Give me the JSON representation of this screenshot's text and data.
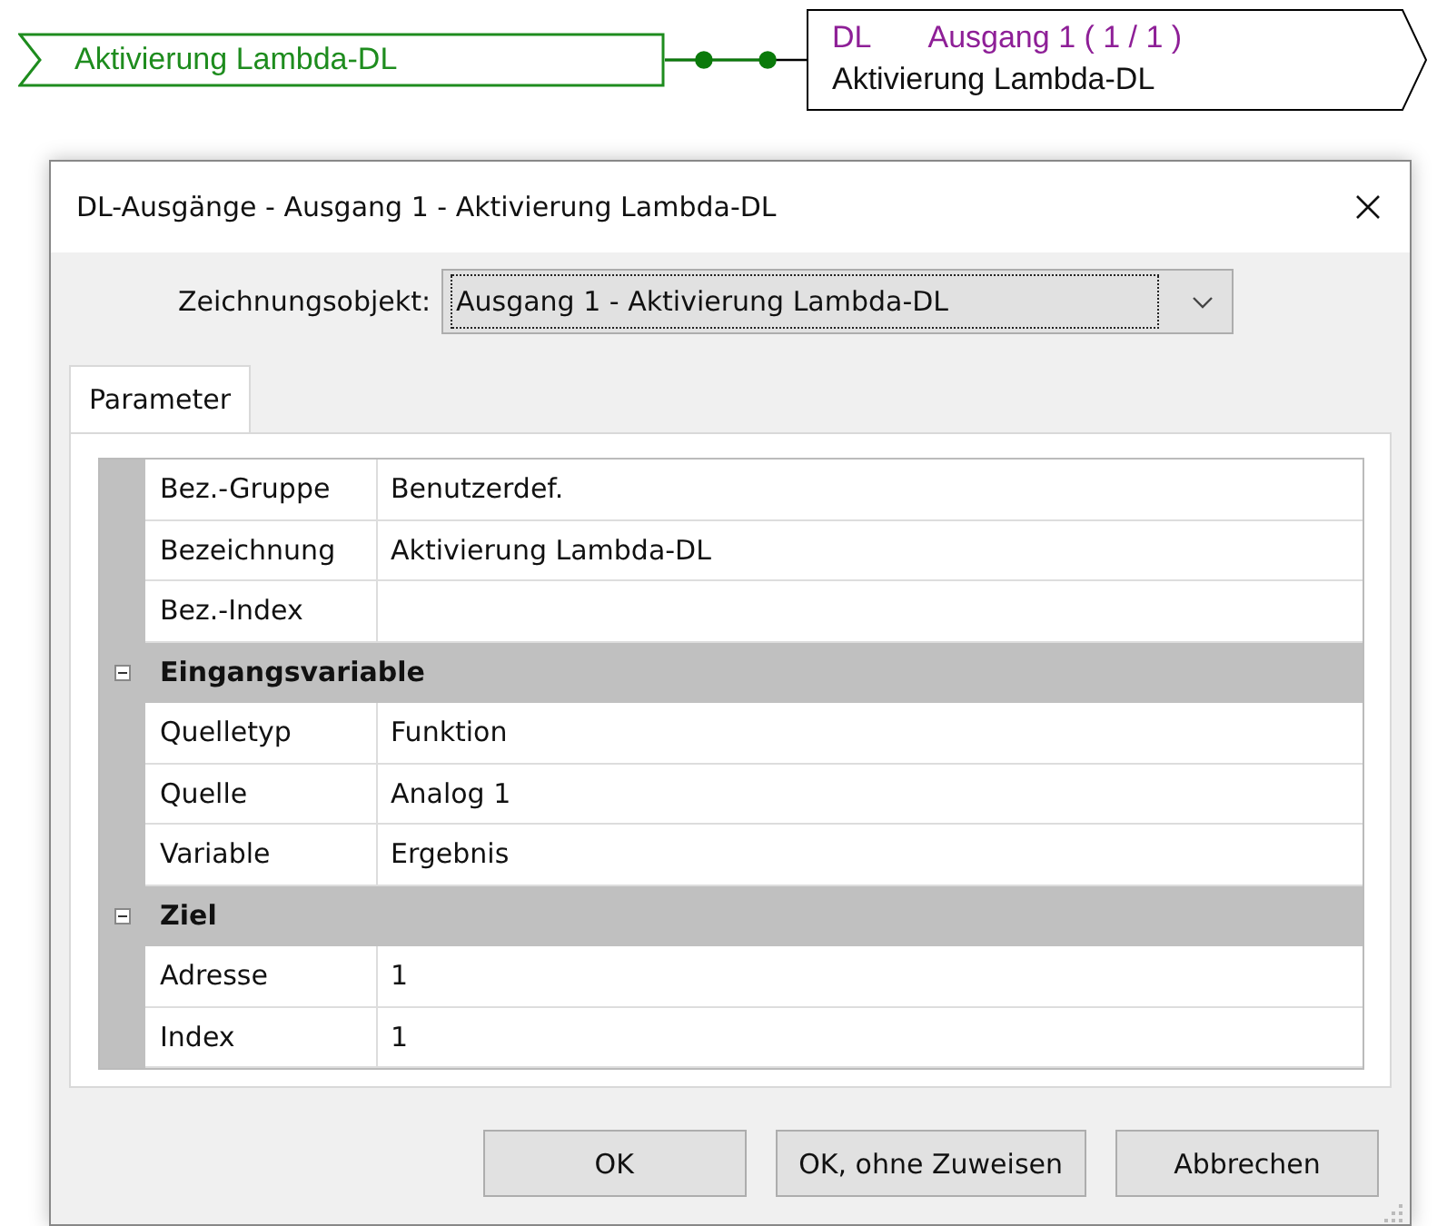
{
  "diagram": {
    "input_tag": "Aktivierung Lambda-DL",
    "output_block": {
      "type": "DL",
      "title": "Ausgang 1 ( 1 / 1 )",
      "name": "Aktivierung Lambda-DL"
    }
  },
  "dialog": {
    "title": "DL-Ausgänge - Ausgang 1 - Aktivierung Lambda-DL",
    "object_label": "Zeichnungsobjekt:",
    "object_value": "Ausgang 1 - Aktivierung Lambda-DL",
    "tabs": [
      {
        "label": "Parameter",
        "selected": true
      }
    ],
    "properties": [
      {
        "kind": "row",
        "label": "Bez.-Gruppe",
        "value": "Benutzerdef."
      },
      {
        "kind": "row",
        "label": "Bezeichnung",
        "value": "Aktivierung Lambda-DL"
      },
      {
        "kind": "row",
        "label": "Bez.-Index"
      },
      {
        "kind": "group",
        "label": "Eingangsvariable",
        "expanded": true
      },
      {
        "kind": "row",
        "label": "Quelletyp",
        "value": "Funktion"
      },
      {
        "kind": "row",
        "label": "Quelle",
        "value": "Analog 1"
      },
      {
        "kind": "row",
        "label": "Variable",
        "value": "Ergebnis"
      },
      {
        "kind": "group",
        "label": "Ziel",
        "expanded": true
      },
      {
        "kind": "row",
        "label": "Adresse",
        "value": "1"
      },
      {
        "kind": "row",
        "label": "Index",
        "value": "1"
      }
    ],
    "buttons": [
      "OK",
      "OK, ohne Zuweisen",
      "Abbrechen"
    ]
  }
}
